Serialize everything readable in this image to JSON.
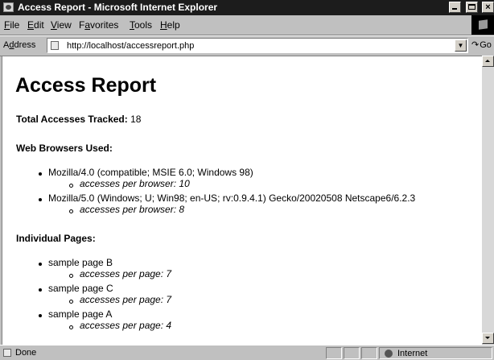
{
  "window": {
    "title": "Access Report - Microsoft Internet Explorer",
    "controls": {
      "minimize": "_",
      "maximize": "□",
      "close": "×"
    }
  },
  "menu": {
    "items": [
      {
        "mnemonic": "F",
        "rest": "ile"
      },
      {
        "mnemonic": "E",
        "rest": "dit"
      },
      {
        "mnemonic": "V",
        "rest": "iew"
      },
      {
        "mnemonic": "a",
        "pre": "F",
        "rest": "vorites"
      },
      {
        "mnemonic": "T",
        "rest": "ools"
      },
      {
        "mnemonic": "H",
        "rest": "elp"
      }
    ]
  },
  "address": {
    "label_pre": "A",
    "label_mnemonic": "d",
    "label_rest": "dress",
    "value": "http://localhost/accessreport.php",
    "go_label": "Go",
    "dropdown": "▼",
    "go_arrow": "↷"
  },
  "page": {
    "heading": "Access Report",
    "total_label": "Total Accesses Tracked:",
    "total_value": "18",
    "browsers_heading": "Web Browsers Used:",
    "browsers": [
      {
        "name": "Mozilla/4.0 (compatible; MSIE 6.0; Windows 98)",
        "label": "accesses per browser:",
        "count": "10"
      },
      {
        "name": "Mozilla/5.0 (Windows; U; Win98; en-US; rv:0.9.4.1) Gecko/20020508 Netscape6/6.2.3",
        "label": "accesses per browser:",
        "count": "8"
      }
    ],
    "pages_heading": "Individual Pages:",
    "pages": [
      {
        "name": "sample page B",
        "label": "accesses per page:",
        "count": "7"
      },
      {
        "name": "sample page C",
        "label": "accesses per page:",
        "count": "7"
      },
      {
        "name": "sample page A",
        "label": "accesses per page:",
        "count": "4"
      }
    ]
  },
  "status": {
    "text": "Done",
    "zone": "Internet"
  }
}
